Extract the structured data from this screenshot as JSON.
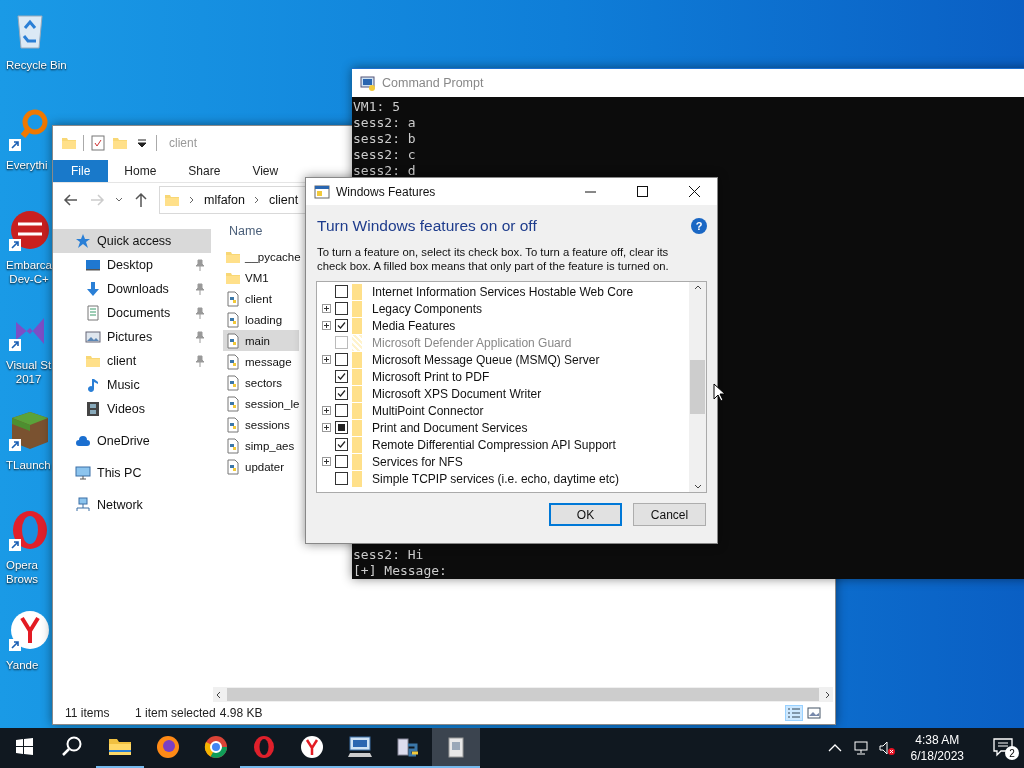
{
  "desktop_icons": [
    {
      "label_lines": [
        "Recycle Bin"
      ],
      "shortcut": false
    },
    {
      "label_lines": [
        "Everythi"
      ],
      "shortcut": true
    },
    {
      "label_lines": [
        "Embarca",
        "Dev-C+"
      ],
      "shortcut": true
    },
    {
      "label_lines": [
        "Visual St",
        "2017"
      ],
      "shortcut": true
    },
    {
      "label_lines": [
        "TLaunch"
      ],
      "shortcut": true
    },
    {
      "label_lines": [
        "Opera",
        "Brows"
      ],
      "shortcut": true
    },
    {
      "label_lines": [
        "Yande"
      ],
      "shortcut": true
    }
  ],
  "explorer": {
    "title": "client",
    "ribbon_tabs": [
      {
        "label": "File",
        "kind": "menu"
      },
      {
        "label": "Home",
        "kind": "tab"
      },
      {
        "label": "Share",
        "kind": "tab"
      },
      {
        "label": "View",
        "kind": "tab"
      }
    ],
    "path": [
      "mlfafon",
      "client"
    ],
    "nav": [
      {
        "label": "Quick access",
        "selected": true,
        "pinned": false,
        "children": [
          {
            "label": "Desktop",
            "selected": false,
            "pinned": true
          },
          {
            "label": "Downloads",
            "selected": false,
            "pinned": true
          },
          {
            "label": "Documents",
            "selected": false,
            "pinned": true
          },
          {
            "label": "Pictures",
            "selected": false,
            "pinned": true
          },
          {
            "label": "client",
            "selected": false,
            "pinned": true
          },
          {
            "label": "Music",
            "selected": false,
            "pinned": false
          },
          {
            "label": "Videos",
            "selected": false,
            "pinned": false
          }
        ]
      },
      {
        "label": "OneDrive",
        "selected": false,
        "pinned": false
      },
      {
        "label": "This PC",
        "selected": false,
        "pinned": false
      },
      {
        "label": "Network",
        "selected": false,
        "pinned": false
      }
    ],
    "column": "Name",
    "files": [
      {
        "name": "__pycache",
        "kind": "folder",
        "selected": false
      },
      {
        "name": "VM1",
        "kind": "folder",
        "selected": false
      },
      {
        "name": "client",
        "kind": "file",
        "selected": false
      },
      {
        "name": "loading",
        "kind": "file",
        "selected": false
      },
      {
        "name": "main",
        "kind": "file",
        "selected": true
      },
      {
        "name": "message",
        "kind": "file",
        "selected": false
      },
      {
        "name": "sectors",
        "kind": "file",
        "selected": false
      },
      {
        "name": "session_le",
        "kind": "file",
        "selected": false
      },
      {
        "name": "sessions",
        "kind": "file",
        "selected": false
      },
      {
        "name": "simp_aes",
        "kind": "file",
        "selected": false
      },
      {
        "name": "updater",
        "kind": "file",
        "selected": false
      }
    ],
    "status": {
      "count": "11 items",
      "selection": "1 item selected",
      "size": "4.98 KB"
    }
  },
  "command_prompt": {
    "title": "Command Prompt",
    "lines": [
      "VM1: 5",
      "sess2: a",
      "sess2: b",
      "sess2: c",
      "sess2: d"
    ],
    "bottom_lines": [
      "sess2: Hi",
      "[+] Message:"
    ]
  },
  "features_dialog": {
    "title": "Windows Features",
    "heading": "Turn Windows features on or off",
    "help": "?",
    "description": "To turn a feature on, select its check box. To turn a feature off, clear its check box. A filled box means that only part of the feature is turned on.",
    "features": [
      {
        "label": "Internet Information Services Hostable Web Core",
        "expandable": false,
        "checked": false,
        "partial": false,
        "disabled": false
      },
      {
        "label": "Legacy Components",
        "expandable": true,
        "checked": false,
        "partial": false,
        "disabled": false
      },
      {
        "label": "Media Features",
        "expandable": true,
        "checked": true,
        "partial": false,
        "disabled": false
      },
      {
        "label": "Microsoft Defender Application Guard",
        "expandable": false,
        "checked": false,
        "partial": false,
        "disabled": true
      },
      {
        "label": "Microsoft Message Queue (MSMQ) Server",
        "expandable": true,
        "checked": false,
        "partial": false,
        "disabled": false
      },
      {
        "label": "Microsoft Print to PDF",
        "expandable": false,
        "checked": true,
        "partial": false,
        "disabled": false
      },
      {
        "label": "Microsoft XPS Document Writer",
        "expandable": false,
        "checked": true,
        "partial": false,
        "disabled": false
      },
      {
        "label": "MultiPoint Connector",
        "expandable": true,
        "checked": false,
        "partial": false,
        "disabled": false
      },
      {
        "label": "Print and Document Services",
        "expandable": true,
        "checked": false,
        "partial": true,
        "disabled": false
      },
      {
        "label": "Remote Differential Compression API Support",
        "expandable": false,
        "checked": true,
        "partial": false,
        "disabled": false
      },
      {
        "label": "Services for NFS",
        "expandable": true,
        "checked": false,
        "partial": false,
        "disabled": false
      },
      {
        "label": "Simple TCPIP services (i.e. echo, daytime etc)",
        "expandable": false,
        "checked": false,
        "partial": false,
        "disabled": false
      }
    ],
    "buttons": [
      {
        "label": "OK",
        "default": true
      },
      {
        "label": "Cancel",
        "default": false
      }
    ]
  },
  "taskbar": {
    "apps": [
      {
        "running": true,
        "selected": false
      },
      {
        "running": false,
        "selected": false
      },
      {
        "running": false,
        "selected": false
      },
      {
        "running": true,
        "selected": false
      },
      {
        "running": true,
        "selected": false
      },
      {
        "running": true,
        "selected": false
      },
      {
        "running": true,
        "selected": false
      },
      {
        "running": true,
        "selected": true
      }
    ],
    "time": "4:38 AM",
    "date": "6/18/2023",
    "notifications": "2"
  }
}
